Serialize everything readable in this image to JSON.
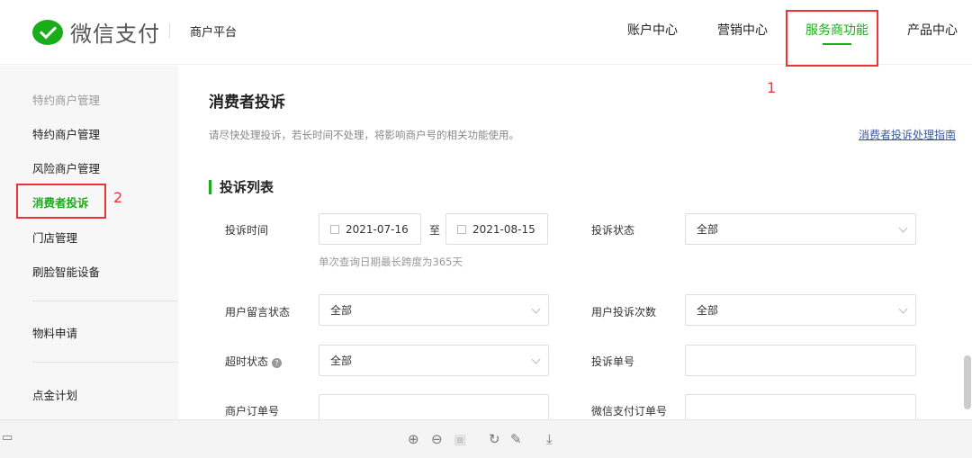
{
  "header": {
    "brand": "微信支付",
    "platform": "商户平台",
    "nav": [
      "账户中心",
      "营销中心",
      "服务商功能",
      "产品中心"
    ],
    "active_nav": "服务商功能"
  },
  "annotations": {
    "one": "1",
    "two": "2"
  },
  "sidebar": {
    "group": "特约商户管理",
    "items": [
      "特约商户管理",
      "风险商户管理",
      "消费者投诉",
      "门店管理",
      "刷脸智能设备"
    ],
    "item2": "物料申请",
    "item3": "点金计划"
  },
  "main": {
    "title": "消费者投诉",
    "hint": "请尽快处理投诉，若长时间不处理，将影响商户号的相关功能使用。",
    "guide_link": "消费者投诉处理指南",
    "section": "投诉列表"
  },
  "form": {
    "time_label": "投诉时间",
    "start_date": "2021-07-16",
    "to": "至",
    "end_date": "2021-08-15",
    "date_note": "单次查询日期最长跨度为365天",
    "status_label": "投诉状态",
    "status_value": "全部",
    "msg_label": "用户留言状态",
    "msg_value": "全部",
    "count_label": "用户投诉次数",
    "count_value": "全部",
    "timeout_label": "超时状态",
    "timeout_help": "?",
    "timeout_value": "全部",
    "complaint_no_label": "投诉单号",
    "order_no_label": "商户订单号",
    "wx_order_label": "微信支付订单号"
  },
  "toolbar": {
    "icons": [
      "zoom-in",
      "zoom-out",
      "fit",
      "rotate",
      "edit",
      "download"
    ]
  }
}
